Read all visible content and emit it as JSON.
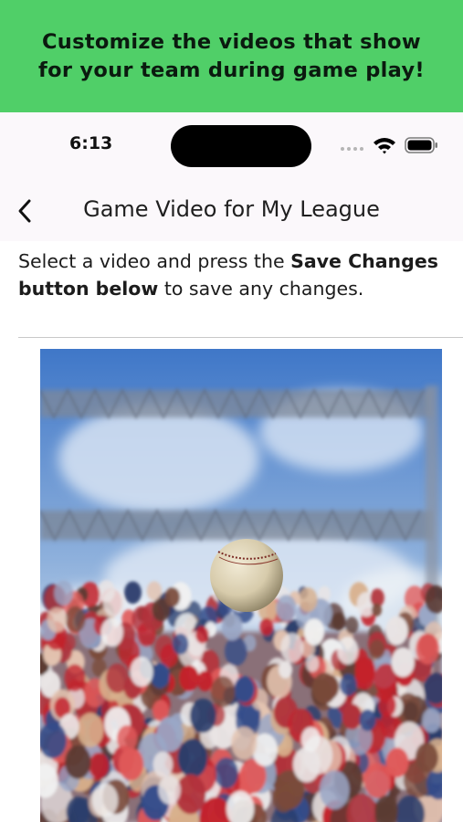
{
  "banner": {
    "line1": "Customize the videos that show",
    "line2": "for your team during game play!",
    "color": "#50cf68"
  },
  "status_bar": {
    "time": "6:13",
    "icons": [
      "signal-dots-icon",
      "wifi-icon",
      "battery-icon"
    ]
  },
  "nav": {
    "back_icon": "chevron-left-icon",
    "title": "Game Video for My League"
  },
  "instructions": {
    "part1": "Select a video and press the ",
    "bold": "Save Changes button below",
    "part2": " to save any changes."
  },
  "video": {
    "icon": "baseball-crowd-video-thumbnail"
  }
}
